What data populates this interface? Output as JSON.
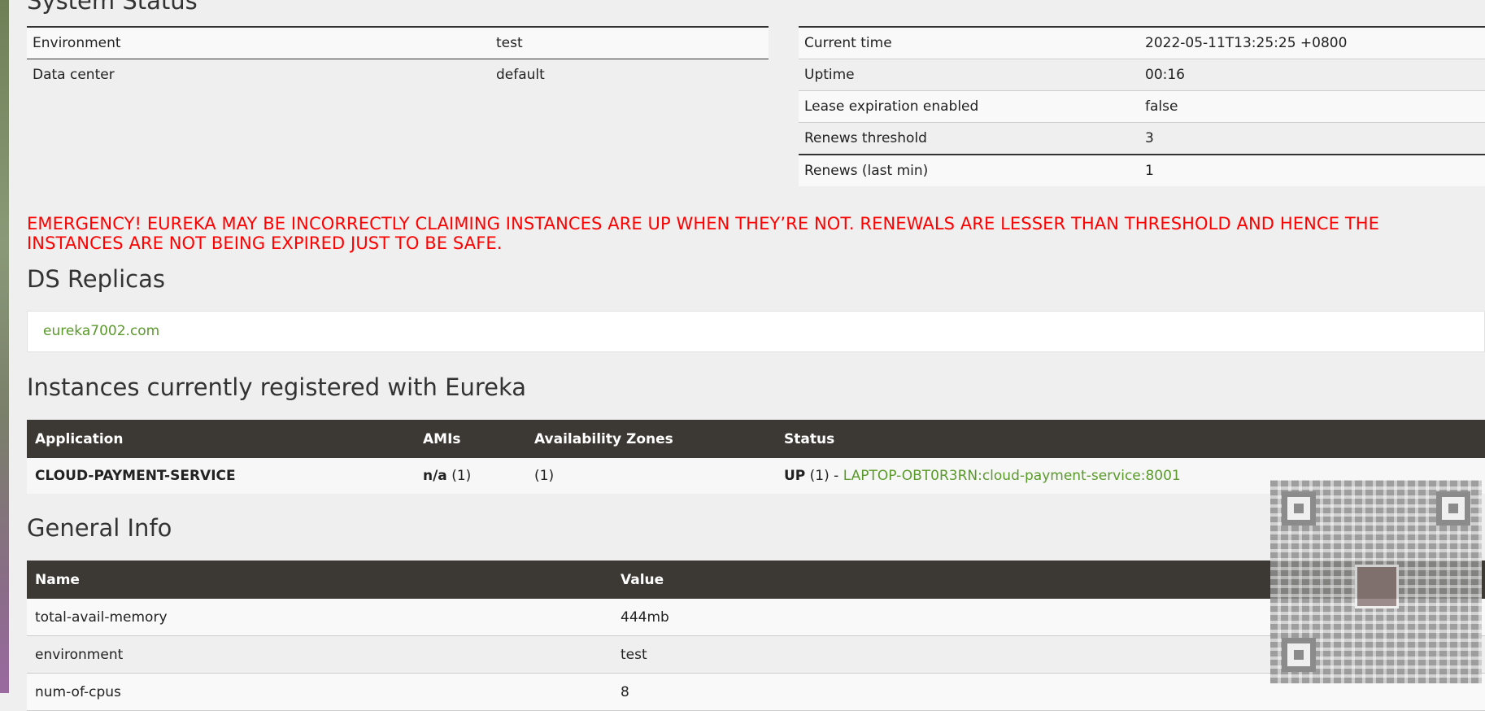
{
  "system_status": {
    "title": "System Status",
    "left_rows": [
      {
        "key": "Environment",
        "value": "test"
      },
      {
        "key": "Data center",
        "value": "default"
      }
    ],
    "right_rows": [
      {
        "key": "Current time",
        "value": "2022-05-11T13:25:25 +0800"
      },
      {
        "key": "Uptime",
        "value": "00:16"
      },
      {
        "key": "Lease expiration enabled",
        "value": "false"
      },
      {
        "key": "Renews threshold",
        "value": "3"
      },
      {
        "key": "Renews (last min)",
        "value": "1"
      }
    ]
  },
  "emergency": {
    "line1": "EMERGENCY! EUREKA MAY BE INCORRECTLY CLAIMING INSTANCES ARE UP WHEN THEY’RE NOT. RENEWALS ARE LESSER THAN THRESHOLD AND HENCE THE",
    "line2": "INSTANCES ARE NOT BEING EXPIRED JUST TO BE SAFE."
  },
  "ds_replicas": {
    "title": "DS Replicas",
    "link": "eureka7002.com"
  },
  "instances": {
    "title": "Instances currently registered with Eureka",
    "headers": [
      "Application",
      "AMIs",
      "Availability Zones",
      "Status"
    ],
    "rows": [
      {
        "application": "CLOUD-PAYMENT-SERVICE",
        "amis_bold": "n/a",
        "amis_count": "(1)",
        "zones": "(1)",
        "status_bold": "UP",
        "status_count": "(1) -",
        "status_link": "LAPTOP-OBT0R3RN:cloud-payment-service:8001"
      }
    ]
  },
  "general_info": {
    "title": "General Info",
    "headers": [
      "Name",
      "Value"
    ],
    "rows": [
      {
        "key": "total-avail-memory",
        "value": "444mb"
      },
      {
        "key": "environment",
        "value": "test"
      },
      {
        "key": "num-of-cpus",
        "value": "8"
      }
    ]
  },
  "overlay": {
    "icon": "qr-code-icon"
  }
}
